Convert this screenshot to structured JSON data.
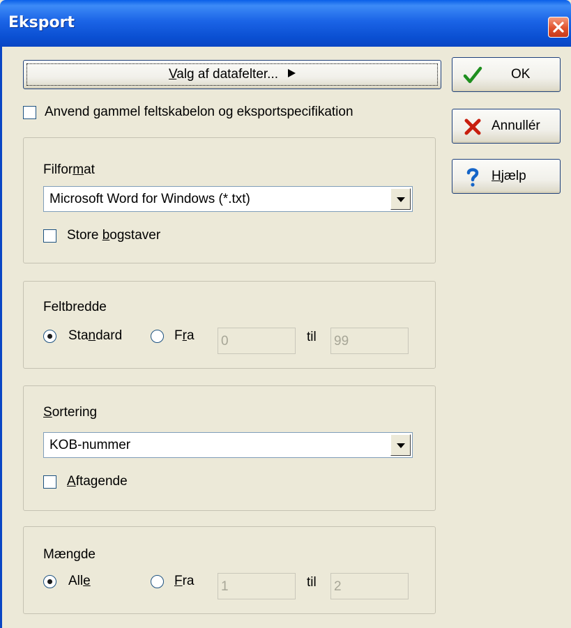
{
  "window": {
    "title": "Eksport"
  },
  "buttons": {
    "valg_pre": "",
    "valg_u": "V",
    "valg_post": "alg af datafelter...",
    "ok_label": "OK",
    "cancel_label": "Annullér",
    "help_u": "H",
    "help_post": "jælp"
  },
  "options": {
    "use_old_label": "Anvend gammel feltskabelon og eksportspecifikation"
  },
  "filformat": {
    "heading_pre": "Filfor",
    "heading_u": "m",
    "heading_post": "at",
    "selected": "Microsoft Word for Windows (*.txt)",
    "store_pre": "Store ",
    "store_u": "b",
    "store_post": "ogstaver"
  },
  "feltbredde": {
    "heading": "Feltbredde",
    "standard_pre": "Sta",
    "standard_u": "n",
    "standard_post": "dard",
    "fra_pre": "F",
    "fra_u": "r",
    "fra_post": "a",
    "from_value": "0",
    "til_label": "til",
    "to_value": "99"
  },
  "sortering": {
    "heading_u": "S",
    "heading_post": "ortering",
    "selected": "KOB-nummer",
    "aftagende_u": "A",
    "aftagende_post": "ftagende"
  },
  "maengde": {
    "heading": "Mængde",
    "alle_pre": "All",
    "alle_u": "e",
    "fra_u": "F",
    "fra_post": "ra",
    "from_value": "1",
    "til_label": "til",
    "to_value": "2"
  },
  "colors": {
    "titlebar": "#0a4fd2",
    "dialog_bg": "#ece9d8",
    "ok_check": "#1f8f1f",
    "cancel_x": "#c81e0e",
    "help_q": "#1565c8"
  },
  "icons": {
    "ok": "checkmark-icon",
    "cancel": "x-icon",
    "help": "question-icon",
    "close": "close-icon"
  }
}
